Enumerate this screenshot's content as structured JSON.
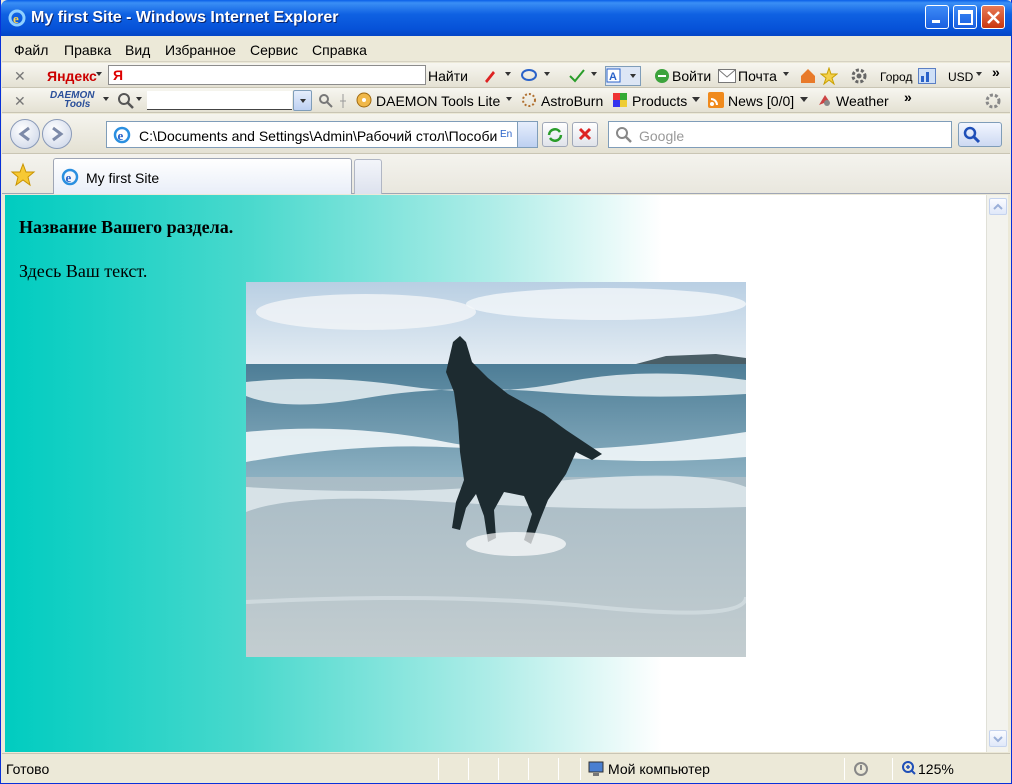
{
  "window": {
    "title": "My first Site - Windows Internet Explorer"
  },
  "menu": [
    "Файл",
    "Правка",
    "Вид",
    "Избранное",
    "Сервис",
    "Справка"
  ],
  "yandex_bar": {
    "brand": "Яндекс",
    "input_glyph": "Я",
    "find": "Найти",
    "login": "Войти",
    "mail": "Почта",
    "city": "Город",
    "currency": "USD",
    "more": "»"
  },
  "daemon_bar": {
    "brand_line1": "DAEMON",
    "brand_line2": "Tools",
    "daemon_link": "DAEMON Tools Lite",
    "astroburn": "AstroBurn",
    "products": "Products",
    "news": "News [0/0]",
    "weather": "Weather",
    "more": "»"
  },
  "address_bar": {
    "url": "C:\\Documents and Settings\\Admin\\Рабочий стол\\Пособи",
    "search_placeholder": "Google"
  },
  "tabs": [
    {
      "label": "My first Site"
    }
  ],
  "page": {
    "heading": "Название Вашего раздела.",
    "text": "Здесь Ваш текст."
  },
  "status": {
    "ready": "Готово",
    "zone": "Мой компьютер",
    "zoom": "125%"
  },
  "colors": {
    "gradient_start": "#00ccc0",
    "titlebar": "#0652d8"
  }
}
